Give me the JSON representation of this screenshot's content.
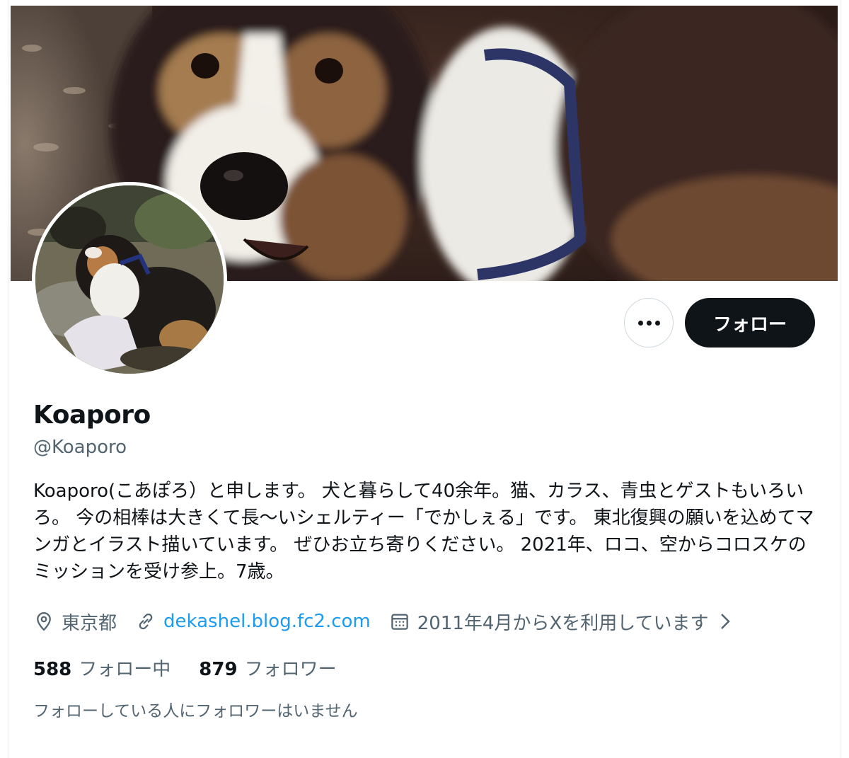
{
  "profile": {
    "display_name": "Koaporo",
    "handle": "@Koaporo",
    "bio": "Koaporo(こあぽろ）と申します。 犬と暮らして40余年。猫、カラス、青虫とゲストもいろいろ。 今の相棒は大きくて長〜いシェルティー「でかしぇる」です。 東北復興の願いを込めてマンガとイラスト描いています。 ぜひお立ち寄りください。 2021年、ロコ、空からコロスケのミッションを受け参上。7歳。",
    "location": "東京都",
    "website": "dekashel.blog.fc2.com",
    "joined": "2011年4月からXを利用しています"
  },
  "actions": {
    "follow_label": "フォロー",
    "more_icon": "more-dots-icon"
  },
  "stats": {
    "following_count": "588",
    "following_label": "フォロー中",
    "followers_count": "879",
    "followers_label": "フォロワー"
  },
  "known_followers_text": "フォローしている人にフォロワーはいません",
  "icons": {
    "location": "map-pin-icon",
    "link": "link-icon",
    "joined": "calendar-icon",
    "chevron": "chevron-right-icon"
  },
  "colors": {
    "follow_button_bg": "#0f1419",
    "link": "#1d9bf0",
    "secondary_text": "#536471"
  }
}
